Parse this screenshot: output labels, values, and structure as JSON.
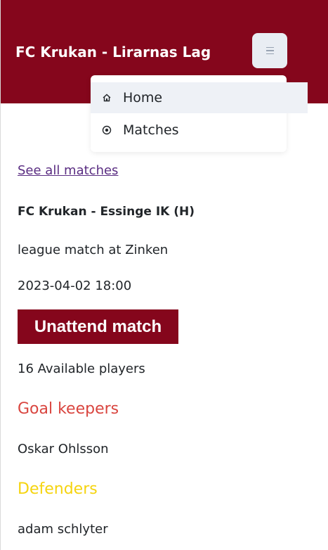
{
  "header": {
    "title": "FC Krukan - Lirarnas Lag",
    "menu_icon": "hamburger-icon"
  },
  "nav_menu": {
    "items": [
      {
        "label": "Home",
        "icon": "home-icon",
        "active": true
      },
      {
        "label": "Matches",
        "icon": "target-icon",
        "active": false
      }
    ]
  },
  "match": {
    "see_all_link": "See all matches",
    "title": "FC Krukan - Essinge IK (H)",
    "type_location": "league match at Zinken",
    "datetime": "2023-04-02 18:00",
    "action_button": "Unattend match",
    "available_players": "16 Available players"
  },
  "squad": {
    "goalkeepers": {
      "heading": "Goal keepers",
      "players": [
        "Oskar Ohlsson"
      ]
    },
    "defenders": {
      "heading": "Defenders",
      "players": [
        "adam schlyter"
      ]
    }
  },
  "colors": {
    "brand": "#85061c",
    "goalkeepers_heading": "#d9453f",
    "defenders_heading": "#f5d40f",
    "link": "#5a2d82"
  }
}
